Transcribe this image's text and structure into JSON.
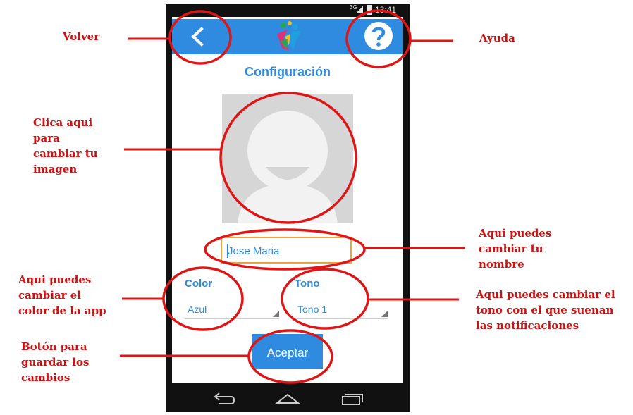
{
  "status_bar": {
    "network": "3G",
    "time": "13:41"
  },
  "app_bar": {
    "back_icon": "chevron-left-icon",
    "logo_icon": "people-logo-icon",
    "help_icon": "question-mark-icon"
  },
  "screen": {
    "title": "Configuración",
    "name_value": "Jose Maria",
    "color_label": "Color",
    "color_value": "Azul",
    "tone_label": "Tono",
    "tone_value": "Tono 1",
    "accept_label": "Aceptar"
  },
  "annotations": {
    "volver": "Volver",
    "ayuda": "Ayuda",
    "imagen": [
      "Clica aqui",
      "para",
      "cambiar tu",
      "imagen"
    ],
    "nombre": [
      "Aqui puedes",
      "cambiar tu",
      "nombre"
    ],
    "color": [
      "Aqui puedes",
      "cambiar el",
      "color de la app"
    ],
    "tono": [
      "Aqui puedes cambiar el",
      "tono con el que suenan",
      "las notificaciones"
    ],
    "boton": [
      "Botón para",
      "guardar los",
      "cambios"
    ]
  },
  "colors": {
    "accent": "#2f8bdf",
    "annotation": "#d01010",
    "input_border": "#f0a23a"
  }
}
